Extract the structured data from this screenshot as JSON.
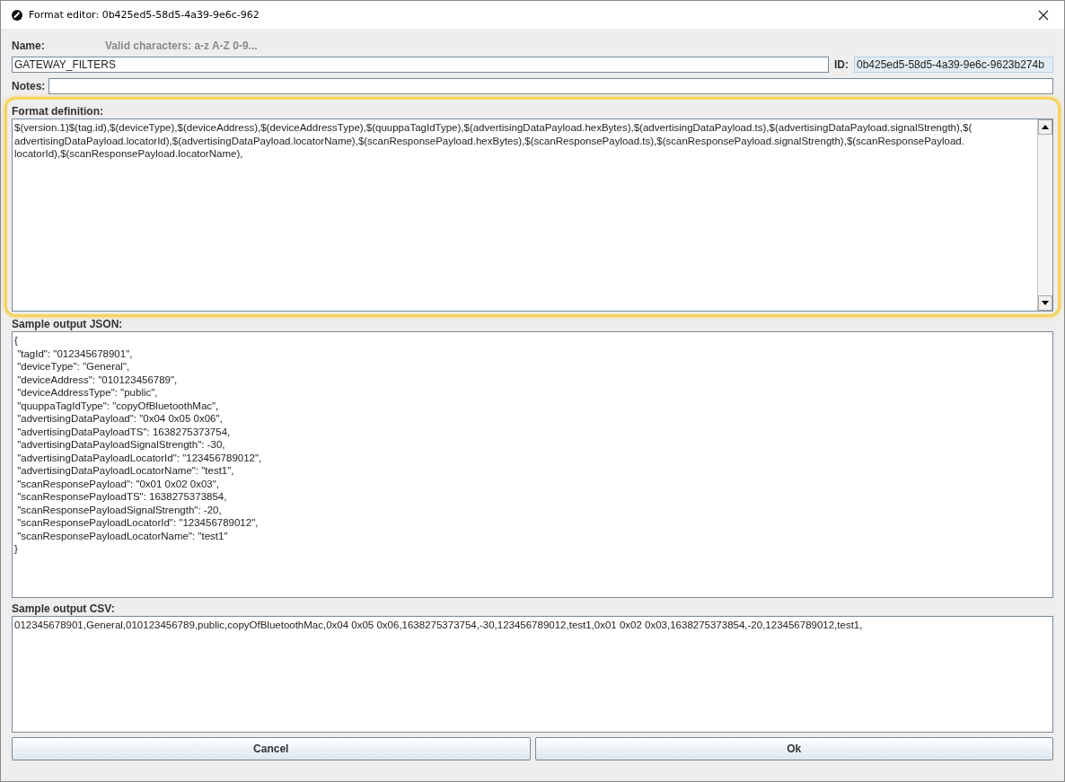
{
  "window": {
    "title": "Format editor: 0b425ed5-58d5-4a39-9e6c-962"
  },
  "name": {
    "label": "Name:",
    "hint": "Valid characters: a-z A-Z 0-9...",
    "value": "GATEWAY_FILTERS"
  },
  "id": {
    "label": "ID:",
    "value": "0b425ed5-58d5-4a39-9e6c-9623b274b"
  },
  "notes": {
    "label": "Notes:"
  },
  "format_definition": {
    "label": "Format definition:",
    "highlighted": true,
    "lines": [
      "$(version.1)$(tag.id),$(deviceType),$(deviceAddress),$(deviceAddressType),$(quuppaTagIdType),$(advertisingDataPayload.hexBytes),$(advertisingDataPayload.ts),$(advertisingDataPayload.signalStrength),$(",
      "advertisingDataPayload.locatorId),$(advertisingDataPayload.locatorName),$(scanResponsePayload.hexBytes),$(scanResponsePayload.ts),$(scanResponsePayload.signalStrength),$(scanResponsePayload.",
      "locatorId),$(scanResponsePayload.locatorName),"
    ]
  },
  "sample_json": {
    "label": "Sample output JSON:",
    "lines": [
      "{",
      " \"tagId\": \"012345678901\",",
      " \"deviceType\": \"General\",",
      " \"deviceAddress\": \"010123456789\",",
      " \"deviceAddressType\": \"public\",",
      " \"quuppaTagIdType\": \"copyOfBluetoothMac\",",
      " \"advertisingDataPayload\": \"0x04 0x05 0x06\",",
      " \"advertisingDataPayloadTS\": 1638275373754,",
      " \"advertisingDataPayloadSignalStrength\": -30,",
      " \"advertisingDataPayloadLocatorId\": \"123456789012\",",
      " \"advertisingDataPayloadLocatorName\": \"test1\",",
      " \"scanResponsePayload\": \"0x01 0x02 0x03\",",
      " \"scanResponsePayloadTS\": 1638275373854,",
      " \"scanResponsePayloadSignalStrength\": -20,",
      " \"scanResponsePayloadLocatorId\": \"123456789012\",",
      " \"scanResponsePayloadLocatorName\": \"test1\"",
      "}"
    ]
  },
  "sample_csv": {
    "label": "Sample output CSV:",
    "value": "012345678901,General,010123456789,public,copyOfBluetoothMac,0x04 0x05 0x06,1638275373754,-30,123456789012,test1,0x01 0x02 0x03,1638275373854,-20,123456789012,test1,"
  },
  "buttons": [
    "Cancel",
    "Ok"
  ]
}
